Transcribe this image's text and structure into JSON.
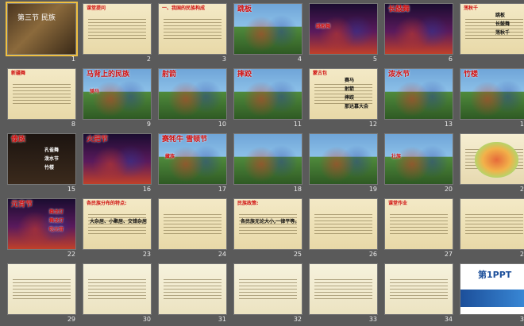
{
  "slides": [
    {
      "n": "1",
      "theme": "lesson",
      "title": "第三节 民族",
      "texts": []
    },
    {
      "n": "2",
      "theme": "paper",
      "title": "课堂提问",
      "texts": []
    },
    {
      "n": "3",
      "theme": "paper",
      "title": "一、我国的民族构成",
      "texts": []
    },
    {
      "n": "4",
      "theme": "photo",
      "title": "跳板",
      "texts": []
    },
    {
      "n": "5",
      "theme": "photo-dark",
      "title": "",
      "texts": [
        "跳板舞"
      ]
    },
    {
      "n": "6",
      "theme": "photo-dark",
      "title": "长鼓舞",
      "texts": []
    },
    {
      "n": "7",
      "theme": "paper",
      "title": "荡秋千",
      "texts": [
        "跳板",
        "长鼓舞",
        "荡秋千"
      ]
    },
    {
      "n": "8",
      "theme": "paper",
      "title": "新疆舞",
      "texts": []
    },
    {
      "n": "9",
      "theme": "photo",
      "title": "马背上的民族",
      "texts": [
        "骑马"
      ]
    },
    {
      "n": "10",
      "theme": "photo",
      "title": "射箭",
      "texts": []
    },
    {
      "n": "11",
      "theme": "photo",
      "title": "摔跤",
      "texts": []
    },
    {
      "n": "12",
      "theme": "paper",
      "title": "蒙古包",
      "texts": [
        "赛马",
        "射箭",
        "摔跤",
        "那达慕大会"
      ]
    },
    {
      "n": "13",
      "theme": "photo",
      "title": "泼水节",
      "texts": []
    },
    {
      "n": "14",
      "theme": "photo",
      "title": "竹楼",
      "texts": []
    },
    {
      "n": "15",
      "theme": "paper-dark",
      "title": "傣族",
      "texts": [
        "孔雀舞",
        "泼水节",
        "竹楼"
      ]
    },
    {
      "n": "16",
      "theme": "photo-dark",
      "title": "火把节",
      "texts": []
    },
    {
      "n": "17",
      "theme": "photo",
      "title": "赛牦牛 雪顿节",
      "texts": [
        "藏族"
      ]
    },
    {
      "n": "18",
      "theme": "photo",
      "title": "",
      "texts": []
    },
    {
      "n": "19",
      "theme": "photo",
      "title": "",
      "texts": []
    },
    {
      "n": "20",
      "theme": "photo",
      "title": "",
      "texts": [
        "壮族"
      ]
    },
    {
      "n": "21",
      "theme": "map",
      "title": "",
      "texts": []
    },
    {
      "n": "22",
      "theme": "photo-dark",
      "title": "元宵节",
      "texts": [
        "舞龙灯",
        "舞龙灯",
        "吃元宵"
      ]
    },
    {
      "n": "23",
      "theme": "paper",
      "title": "各民族分布的特点:",
      "texts": [
        "大杂居、小聚居、交错杂居"
      ]
    },
    {
      "n": "24",
      "theme": "paper",
      "title": "",
      "texts": []
    },
    {
      "n": "25",
      "theme": "paper",
      "title": "民族政策:",
      "texts": [
        "各民族无论大小,一律平等。"
      ]
    },
    {
      "n": "26",
      "theme": "paper",
      "title": "",
      "texts": []
    },
    {
      "n": "27",
      "theme": "paper",
      "title": "课堂作业",
      "texts": []
    },
    {
      "n": "28",
      "theme": "paper",
      "title": "",
      "texts": []
    },
    {
      "n": "29",
      "theme": "blue",
      "title": "",
      "texts": []
    },
    {
      "n": "30",
      "theme": "blue",
      "title": "",
      "texts": []
    },
    {
      "n": "31",
      "theme": "blue",
      "title": "",
      "texts": []
    },
    {
      "n": "32",
      "theme": "blue",
      "title": "",
      "texts": []
    },
    {
      "n": "33",
      "theme": "blue",
      "title": "",
      "texts": []
    },
    {
      "n": "34",
      "theme": "blue",
      "title": "",
      "texts": []
    },
    {
      "n": "35",
      "theme": "logo",
      "title": "第1PPT",
      "texts": []
    }
  ],
  "colors": {
    "background": "#5a5a5a",
    "paper": "#f1e6c1",
    "accent": "#d01010",
    "selection": "#f0c040"
  }
}
